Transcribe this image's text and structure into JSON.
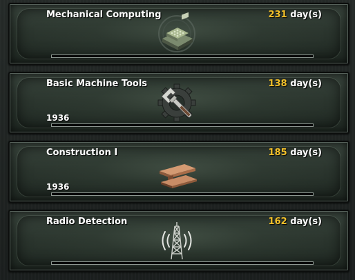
{
  "research": {
    "items": [
      {
        "name": "Mechanical Computing",
        "days": "231",
        "days_unit": "day(s)",
        "year": "",
        "icon": "mechanical-computer-icon",
        "progress": 0
      },
      {
        "name": "Basic Machine Tools",
        "days": "138",
        "days_unit": "day(s)",
        "year": "1936",
        "icon": "gear-wrench-icon",
        "progress": 0
      },
      {
        "name": "Construction I",
        "days": "185",
        "days_unit": "day(s)",
        "year": "1936",
        "icon": "steel-beam-icon",
        "progress": 0
      },
      {
        "name": "Radio Detection",
        "days": "162",
        "days_unit": "day(s)",
        "year": "",
        "icon": "radio-tower-icon",
        "progress": 0
      }
    ]
  },
  "colors": {
    "days_number": "#f2c02a",
    "text": "#ffffff",
    "panel": "#2a342d"
  }
}
